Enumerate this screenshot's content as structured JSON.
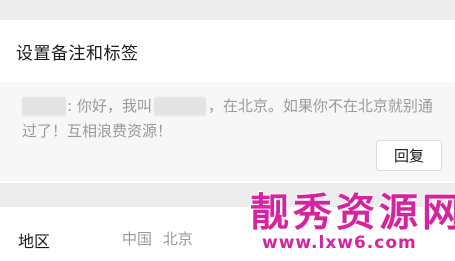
{
  "section": {
    "title": "设置备注和标签"
  },
  "message": {
    "part1": ": 你好，我叫",
    "part2": "，在北京。如果你不在北京就别通过了！互相浪费资源！"
  },
  "reply_button": {
    "label": "回复"
  },
  "region": {
    "label": "地区",
    "value": "中国 北京"
  },
  "watermark": {
    "main": "靓秀资源网",
    "sub": "www.lxw6.com"
  },
  "colors": {
    "background": "#ededed",
    "card": "#ffffff",
    "message_bg": "#f7f7f7",
    "muted_text": "#9a9a9a",
    "watermark": "#d6249f"
  }
}
